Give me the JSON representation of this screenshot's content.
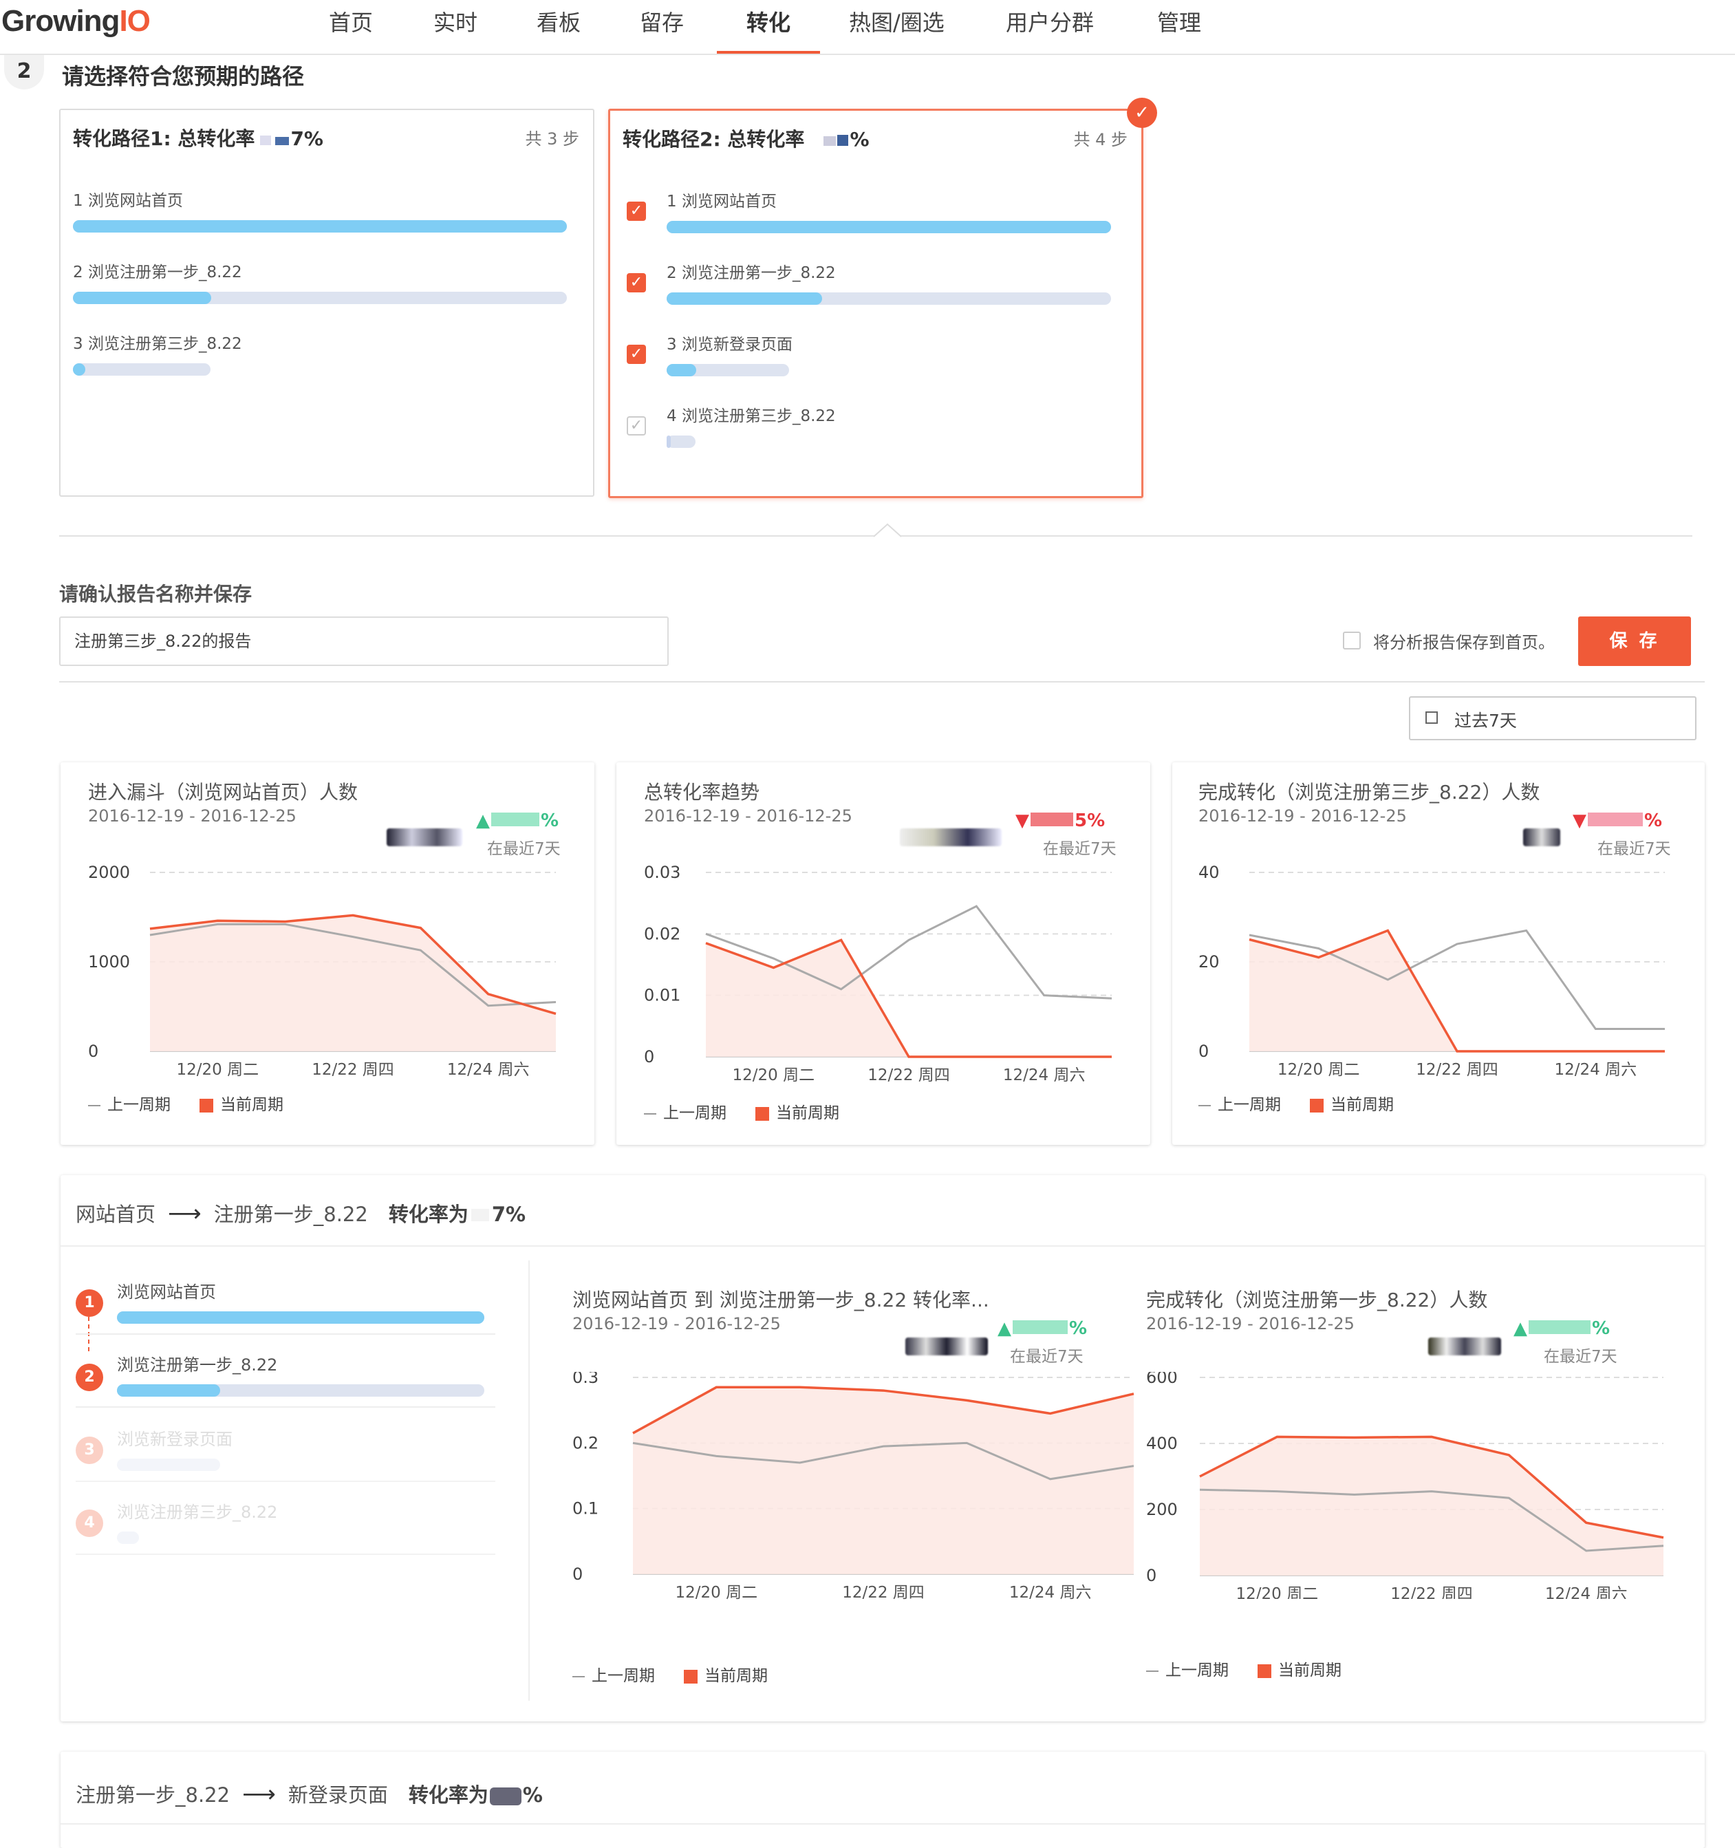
{
  "nav": {
    "logo_a": "Growing",
    "logo_b": "IO",
    "items": [
      "首页",
      "实时",
      "看板",
      "留存",
      "转化",
      "热图/圈选",
      "用户分群",
      "管理"
    ],
    "active": "转化"
  },
  "step": {
    "number": "2",
    "title": "请选择符合您预期的路径"
  },
  "paths": [
    {
      "title": "转化路径1: 总转化率",
      "rate": "7%",
      "steps_label": "共 3 步",
      "rows": [
        {
          "label": "1 浏览网站首页",
          "fill": 1.0
        },
        {
          "label": "2 浏览注册第一步_8.22",
          "fill": 0.28
        },
        {
          "label": "3 浏览注册第三步_8.22",
          "fill": 0.09
        }
      ]
    },
    {
      "title": "转化路径2: 总转化率",
      "rate": "%",
      "steps_label": "共 4 步",
      "rows": [
        {
          "label": "1 浏览网站首页",
          "fill": 1.0,
          "checked": true
        },
        {
          "label": "2 浏览注册第一步_8.22",
          "fill": 0.35,
          "checked": true
        },
        {
          "label": "3 浏览新登录页面",
          "fill": 0.24,
          "checked": true
        },
        {
          "label": "4 浏览注册第三步_8.22",
          "fill": 0.06,
          "checked": false
        }
      ]
    }
  ],
  "save_section": {
    "title": "请确认报告名称并保存",
    "report_name": "注册第三步_8.22的报告",
    "home_checkbox_label": "将分析报告保存到首页。",
    "save_label": "保 存",
    "date_range": "过去7天"
  },
  "charts": [
    {
      "title": "进入漏斗（浏览网站首页）人数",
      "date": "2016-12-19 - 2016-12-25",
      "change": "▲",
      "change_suffix": "%",
      "recent": "在最近7天",
      "legend_prev": "上一周期",
      "legend_cur": "当前周期"
    },
    {
      "title": "总转化率趋势",
      "date": "2016-12-19 - 2016-12-25",
      "change": "▼",
      "change_suffix": "5%",
      "recent": "在最近7天",
      "legend_prev": "上一周期",
      "legend_cur": "当前周期"
    },
    {
      "title": "完成转化（浏览注册第三步_8.22）人数",
      "date": "2016-12-19 - 2016-12-25",
      "change": "▼",
      "change_suffix": "%",
      "recent": "在最近7天",
      "legend_prev": "上一周期",
      "legend_cur": "当前周期"
    }
  ],
  "section1": {
    "from": "网站首页",
    "arrow": "⟶",
    "to": "注册第一步_8.22",
    "rate_label": "转化率为",
    "rate": "7%",
    "funnel": [
      {
        "num": "1",
        "label": "浏览网站首页",
        "fill": 1.0
      },
      {
        "num": "2",
        "label": "浏览注册第一步_8.22",
        "fill": 0.28
      },
      {
        "num": "3",
        "label": "浏览新登录页面",
        "fill": 0.28
      },
      {
        "num": "4",
        "label": "浏览注册第三步_8.22",
        "fill": 0.06
      }
    ],
    "charts": [
      {
        "title": "浏览网站首页 到 浏览注册第一步_8.22 转化率...",
        "date": "2016-12-19 - 2016-12-25",
        "change": "▲",
        "change_suffix": "%",
        "recent": "在最近7天",
        "legend_prev": "上一周期",
        "legend_cur": "当前周期"
      },
      {
        "title": "完成转化（浏览注册第一步_8.22）人数",
        "date": "2016-12-19 - 2016-12-25",
        "change": "▲",
        "change_suffix": "%",
        "recent": "在最近7天",
        "legend_prev": "上一周期",
        "legend_cur": "当前周期"
      }
    ]
  },
  "section2": {
    "from": "注册第一步_8.22",
    "arrow": "⟶",
    "to": "新登录页面",
    "rate_label": "转化率为",
    "rate": "%"
  },
  "colors": {
    "accent": "#f05a38",
    "bar_fill": "#7fcdf4",
    "bar_bg": "#dde3f0",
    "prev_line": "#aaaaaa",
    "area": "#fde8e3"
  },
  "chart_data": [
    {
      "type": "area",
      "title": "进入漏斗（浏览网站首页）人数",
      "x": [
        "12/19",
        "12/20 周二",
        "12/21",
        "12/22 周四",
        "12/23",
        "12/24 周六",
        "12/25"
      ],
      "xticks": [
        "12/20 周二",
        "12/22 周四",
        "12/24 周六"
      ],
      "yticks": [
        "0",
        "1000",
        "2000"
      ],
      "ylim": [
        0,
        2000
      ],
      "series": [
        {
          "name": "上一周期",
          "values": [
            1300,
            1420,
            1420,
            1280,
            1130,
            510,
            550
          ]
        },
        {
          "name": "当前周期",
          "values": [
            1370,
            1460,
            1450,
            1520,
            1380,
            640,
            420
          ]
        }
      ]
    },
    {
      "type": "area",
      "title": "总转化率趋势",
      "x": [
        "12/19",
        "12/20 周二",
        "12/21",
        "12/22 周四",
        "12/23",
        "12/24 周六",
        "12/25"
      ],
      "xticks": [
        "12/20 周二",
        "12/22 周四",
        "12/24 周六"
      ],
      "yticks": [
        "0",
        "0.01",
        "0.02",
        "0.03"
      ],
      "ylim": [
        0,
        0.03
      ],
      "series": [
        {
          "name": "上一周期",
          "values": [
            0.02,
            0.016,
            0.011,
            0.019,
            0.0245,
            0.01,
            0.0095
          ]
        },
        {
          "name": "当前周期",
          "values": [
            0.0185,
            0.0145,
            0.019,
            0.0,
            0.0,
            0.0,
            0.0
          ]
        }
      ]
    },
    {
      "type": "area",
      "title": "完成转化（浏览注册第三步_8.22）人数",
      "x": [
        "12/19",
        "12/20 周二",
        "12/21",
        "12/22 周四",
        "12/23",
        "12/24 周六",
        "12/25"
      ],
      "xticks": [
        "12/20 周二",
        "12/22 周四",
        "12/24 周六"
      ],
      "yticks": [
        "0",
        "20",
        "40"
      ],
      "ylim": [
        0,
        40
      ],
      "series": [
        {
          "name": "上一周期",
          "values": [
            26,
            23,
            16,
            24,
            27,
            5,
            5
          ]
        },
        {
          "name": "当前周期",
          "values": [
            25,
            21,
            27,
            0,
            0,
            0,
            0
          ]
        }
      ]
    },
    {
      "type": "area",
      "title": "浏览网站首页 到 浏览注册第一步_8.22 转化率...",
      "x": [
        "12/19",
        "12/20 周二",
        "12/21",
        "12/22 周四",
        "12/23",
        "12/24 周六",
        "12/25"
      ],
      "xticks": [
        "12/20 周二",
        "12/22 周四",
        "12/24 周六"
      ],
      "yticks": [
        "0",
        "0.1",
        "0.2",
        "0.3"
      ],
      "ylim": [
        0,
        0.3
      ],
      "series": [
        {
          "name": "上一周期",
          "values": [
            0.2,
            0.18,
            0.17,
            0.195,
            0.2,
            0.145,
            0.165
          ]
        },
        {
          "name": "当前周期",
          "values": [
            0.215,
            0.285,
            0.285,
            0.28,
            0.265,
            0.245,
            0.275
          ]
        }
      ]
    },
    {
      "type": "area",
      "title": "完成转化（浏览注册第一步_8.22）人数",
      "x": [
        "12/19",
        "12/20 周二",
        "12/21",
        "12/22 周四",
        "12/23",
        "12/24 周六",
        "12/25"
      ],
      "xticks": [
        "12/20 周二",
        "12/22 周四",
        "12/24 周六"
      ],
      "yticks": [
        "0",
        "200",
        "400",
        "600"
      ],
      "ylim": [
        0,
        600
      ],
      "series": [
        {
          "name": "上一周期",
          "values": [
            260,
            255,
            245,
            255,
            235,
            75,
            90
          ]
        },
        {
          "name": "当前周期",
          "values": [
            300,
            420,
            418,
            420,
            365,
            160,
            115
          ]
        }
      ]
    }
  ]
}
